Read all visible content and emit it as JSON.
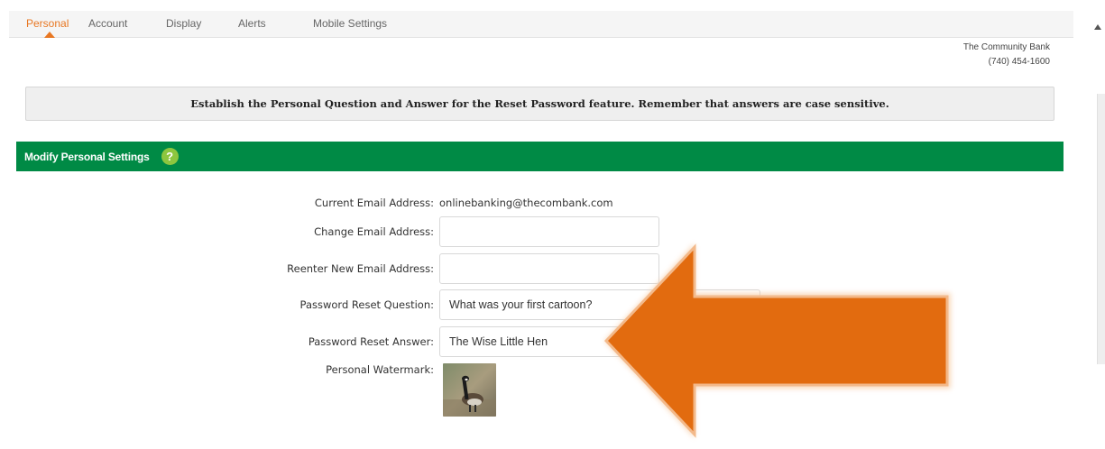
{
  "tabs": [
    {
      "label": "Personal",
      "active": true
    },
    {
      "label": "Account",
      "active": false
    },
    {
      "label": "Display",
      "active": false
    },
    {
      "label": "Alerts",
      "active": false
    },
    {
      "label": "Mobile Settings",
      "active": false
    }
  ],
  "bank": {
    "name": "The Community Bank",
    "phone": "(740) 454-1600"
  },
  "info_message": "Establish the Personal Question and Answer for the Reset Password feature. Remember that answers are case sensitive.",
  "section": {
    "title": "Modify Personal Settings",
    "help_symbol": "?"
  },
  "form": {
    "current_email_label": "Current Email Address:",
    "current_email_value": "onlinebanking@thecombank.com",
    "change_email_label": "Change Email Address:",
    "change_email_value": "",
    "reenter_email_label": "Reenter New Email Address:",
    "reenter_email_value": "",
    "reset_question_label": "Password Reset Question:",
    "reset_question_value": "What was your first cartoon?",
    "reset_answer_label": "Password Reset Answer:",
    "reset_answer_value": "The Wise Little Hen",
    "watermark_label": "Personal Watermark:"
  },
  "colors": {
    "accent_orange": "#e87722",
    "header_green": "#008a45",
    "help_green": "#8dc63f",
    "arrow_orange": "#e26b0f"
  },
  "icons": {
    "help": "help-icon",
    "arrow": "arrow-left-icon",
    "scroll_up": "chevron-up-icon"
  }
}
